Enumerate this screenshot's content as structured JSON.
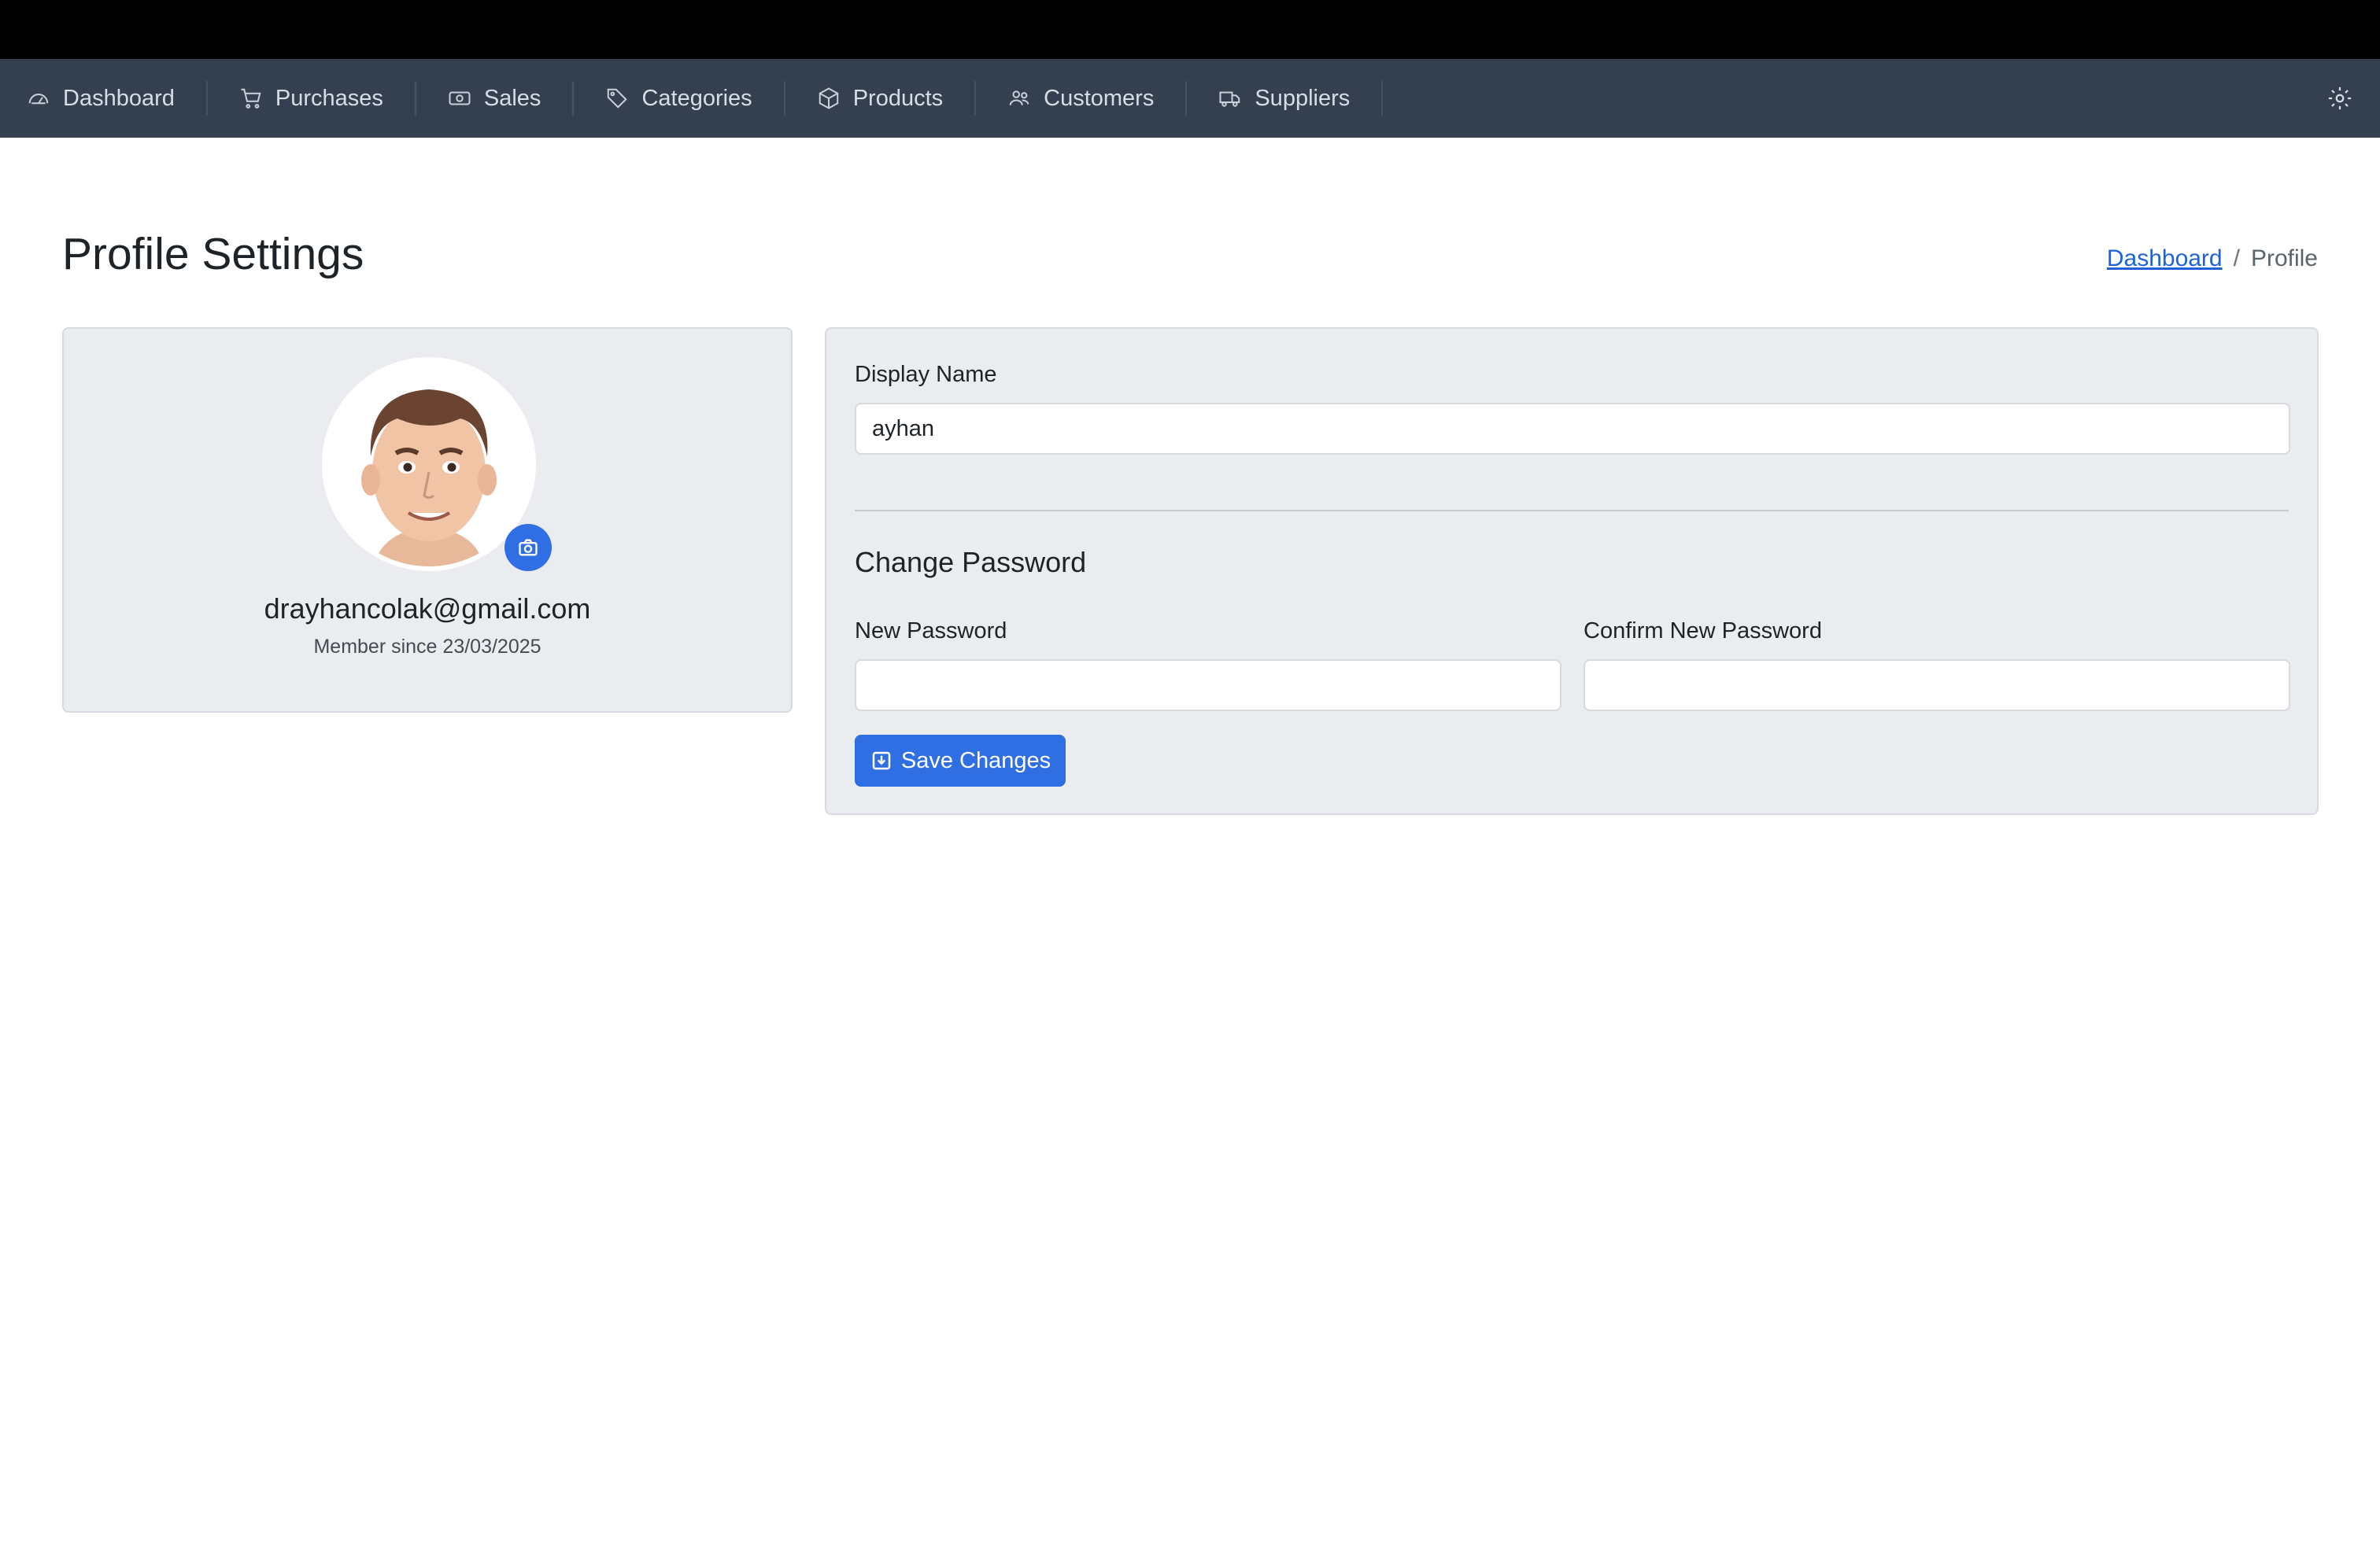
{
  "nav": {
    "items": [
      {
        "label": "Dashboard",
        "icon": "speedometer-icon"
      },
      {
        "label": "Purchases",
        "icon": "cart-icon"
      },
      {
        "label": "Sales",
        "icon": "cash-icon"
      },
      {
        "label": "Categories",
        "icon": "tags-icon"
      },
      {
        "label": "Products",
        "icon": "box-icon"
      },
      {
        "label": "Customers",
        "icon": "people-icon"
      },
      {
        "label": "Suppliers",
        "icon": "truck-icon"
      }
    ],
    "settings_icon": "gear-icon"
  },
  "page": {
    "title": "Profile Settings",
    "breadcrumb": {
      "home": "Dashboard",
      "separator": "/",
      "current": "Profile"
    }
  },
  "profile": {
    "email": "drayhancolak@gmail.com",
    "member_since": "Member since 23/03/2025",
    "avatar_icon": "avatar-icon",
    "camera_icon": "camera-icon"
  },
  "form": {
    "display_name_label": "Display Name",
    "display_name_value": "ayhan",
    "change_password_title": "Change Password",
    "new_password_label": "New Password",
    "new_password_value": "",
    "confirm_password_label": "Confirm New Password",
    "confirm_password_value": "",
    "save_label": "Save Changes"
  },
  "colors": {
    "navbar": "#343f4f",
    "accent": "#2f6fe3",
    "card": "#eaecf0",
    "link": "#1d63d6"
  }
}
